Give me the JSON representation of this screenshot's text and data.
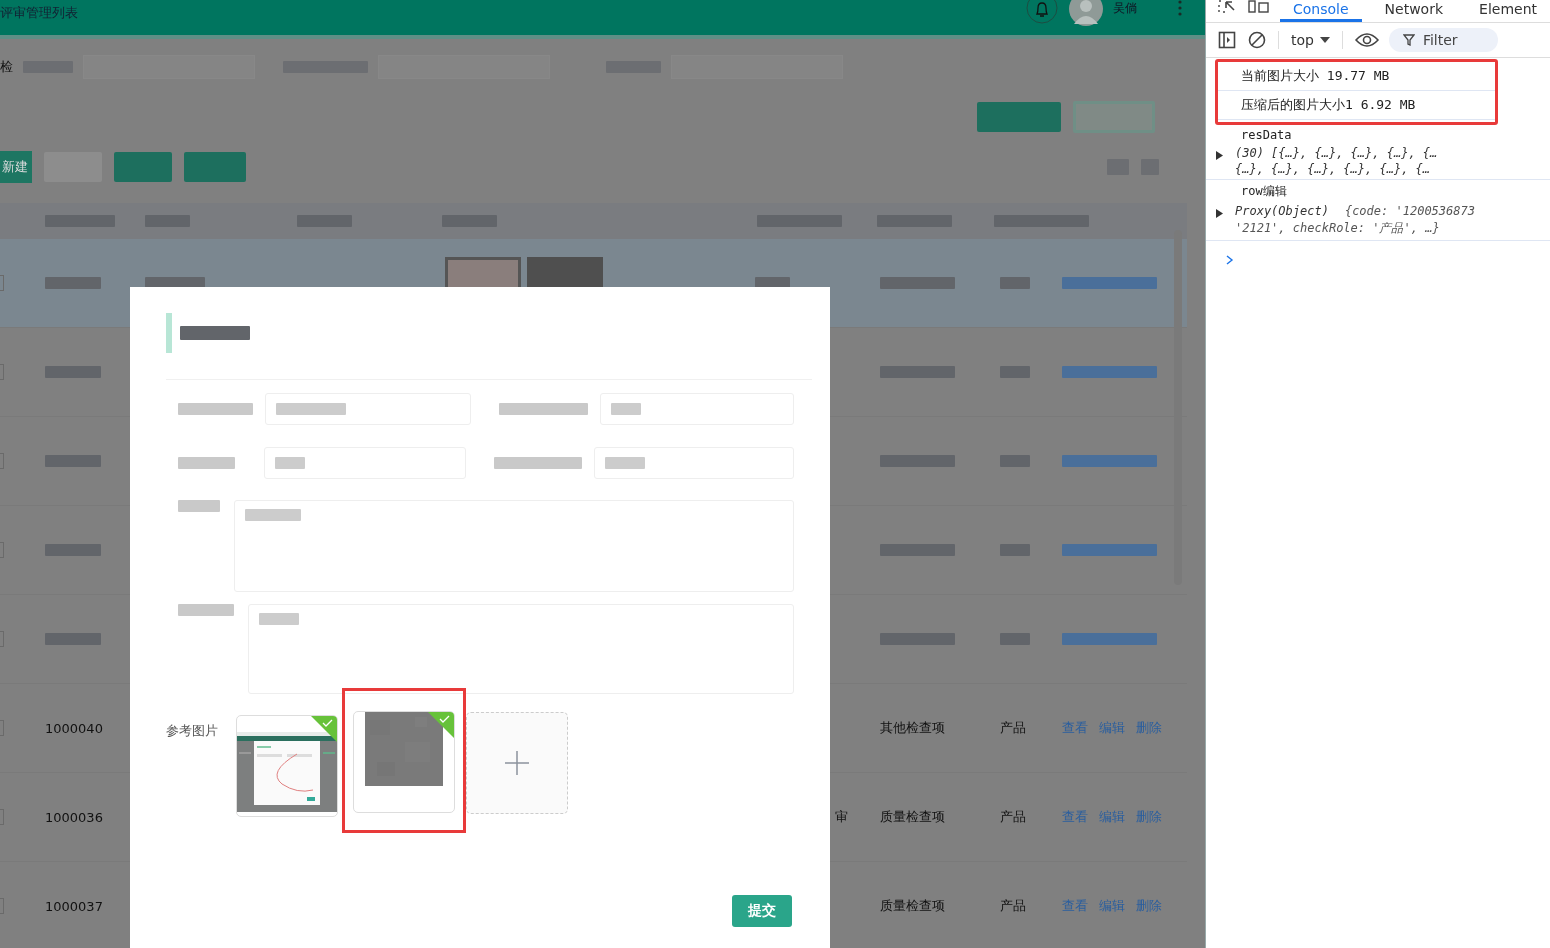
{
  "app": {
    "title": "评审管理列表",
    "user": "吴倘",
    "filter_label": "检",
    "new_button": "新建"
  },
  "table": {
    "rows": [
      {
        "kind": "blurred",
        "selected": true
      },
      {
        "kind": "blurred",
        "selected": false
      },
      {
        "kind": "blurred",
        "selected": false
      },
      {
        "kind": "blurred",
        "selected": false
      },
      {
        "kind": "blurred",
        "selected": false
      },
      {
        "kind": "text",
        "selected": false,
        "id": "1000040",
        "type": "其他检查项",
        "role": "产品",
        "actions": [
          "查看",
          "编辑",
          "删除"
        ]
      },
      {
        "kind": "text",
        "selected": false,
        "id": "1000036",
        "status": "审",
        "type": "质量检查项",
        "role": "产品",
        "actions": [
          "查看",
          "编辑",
          "删除"
        ]
      },
      {
        "kind": "text",
        "selected": false,
        "id": "1000037",
        "type": "质量检查项",
        "role": "产品",
        "actions": [
          "查看",
          "编辑",
          "删除"
        ]
      }
    ]
  },
  "dialog": {
    "image_label": "参考图片",
    "images": [
      {
        "kind": "screenshot",
        "uploaded": true,
        "highlighted": false
      },
      {
        "kind": "noise",
        "uploaded": true,
        "highlighted": true
      }
    ],
    "submit": "提交"
  },
  "devtools": {
    "tabs": [
      {
        "label": "Console",
        "selected": true
      },
      {
        "label": "Network",
        "selected": false
      },
      {
        "label": "Element",
        "selected": false
      }
    ],
    "context": "top",
    "filter_placeholder": "Filter",
    "highlighted_logs": [
      {
        "text": "当前图片大小 19.77 MB"
      },
      {
        "text": "压缩后的图片大小1 6.92 MB"
      }
    ],
    "logs": [
      {
        "text": "resData",
        "details": [
          "(30)  [{…},  {…},  {…},  {…},  {…",
          "{…},  {…},  {…},  {…},  {…},  {…"
        ]
      },
      {
        "text": "row编辑",
        "object": "Proxy(Object)",
        "details": [
          "{code: '1200536873",
          "'2121', checkRole: '产品',  …}"
        ]
      }
    ]
  }
}
